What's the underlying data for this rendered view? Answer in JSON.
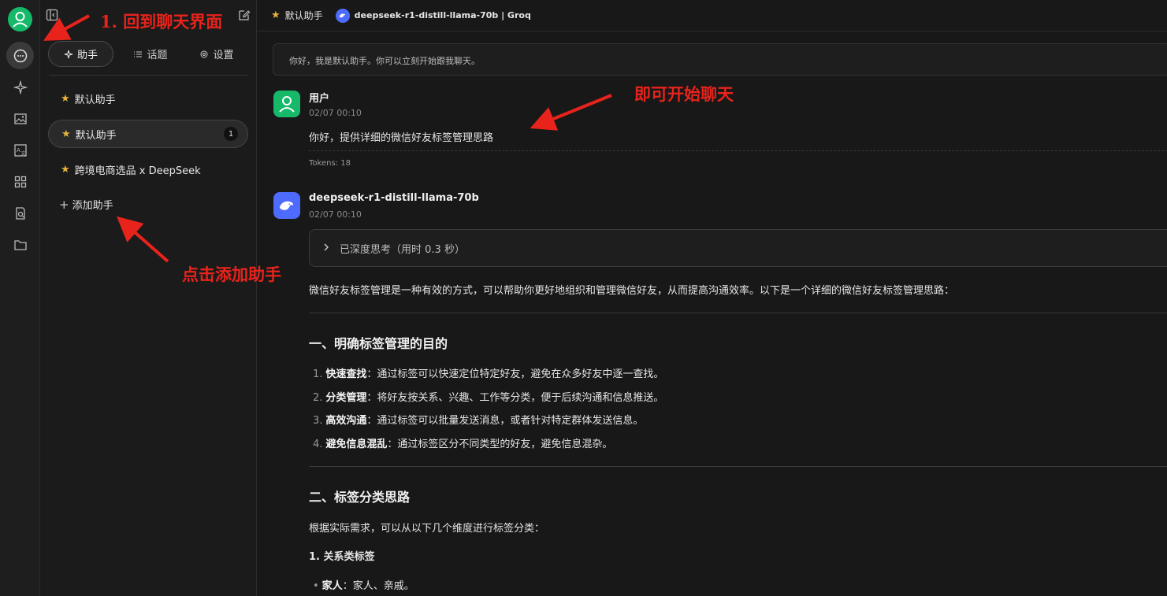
{
  "topbar": {
    "assistant_name": "默认助手",
    "model_label": "deepseek-r1-distill-llama-70b | Groq"
  },
  "panel": {
    "tabs": [
      {
        "label": "助手"
      },
      {
        "label": "话题"
      },
      {
        "label": "设置"
      }
    ],
    "assistants": [
      {
        "label": "默认助手",
        "badge": ""
      },
      {
        "label": "默认助手",
        "badge": "1"
      },
      {
        "label": "跨境电商选品 x DeepSeek",
        "badge": ""
      }
    ],
    "add_label": "添加助手"
  },
  "chat": {
    "greeting": "你好，我是默认助手。你可以立刻开始跟我聊天。",
    "user": {
      "name": "用户",
      "time": "02/07 00:10",
      "text": "你好，提供详细的微信好友标签管理思路",
      "tokens": "Tokens: 18"
    },
    "bot": {
      "name": "deepseek-r1-distill-llama-70b",
      "time": "02/07 00:10",
      "thinking": "已深度思考（用时 0.3 秒）",
      "intro": "微信好友标签管理是一种有效的方式，可以帮助你更好地组织和管理微信好友，从而提高沟通效率。以下是一个详细的微信好友标签管理思路：",
      "h1": "一、明确标签管理的目的",
      "list": [
        {
          "num": "1.",
          "bold": "快速查找",
          "text": "：通过标签可以快速定位特定好友，避免在众多好友中逐一查找。"
        },
        {
          "num": "2.",
          "bold": "分类管理",
          "text": "：将好友按关系、兴趣、工作等分类，便于后续沟通和信息推送。"
        },
        {
          "num": "3.",
          "bold": "高效沟通",
          "text": "：通过标签可以批量发送消息，或者针对特定群体发送信息。"
        },
        {
          "num": "4.",
          "bold": "避免信息混乱",
          "text": "：通过标签区分不同类型的好友，避免信息混杂。"
        }
      ],
      "h2": "二、标签分类思路",
      "para": "根据实际需求，可以从以下几个维度进行标签分类：",
      "sub": "1. 关系类标签",
      "bullet_bold": "家人",
      "bullet_text": "：家人、亲戚。"
    }
  },
  "annotations": {
    "back_to_chat": "1. 回到聊天界面",
    "start_chat": "即可开始聊天",
    "click_add": "点击添加助手"
  },
  "colors": {
    "accent_green": "#16b96a",
    "model_blue": "#4d6bfe",
    "annotation_red": "#e8231b",
    "star_gold": "#e8b33c"
  }
}
